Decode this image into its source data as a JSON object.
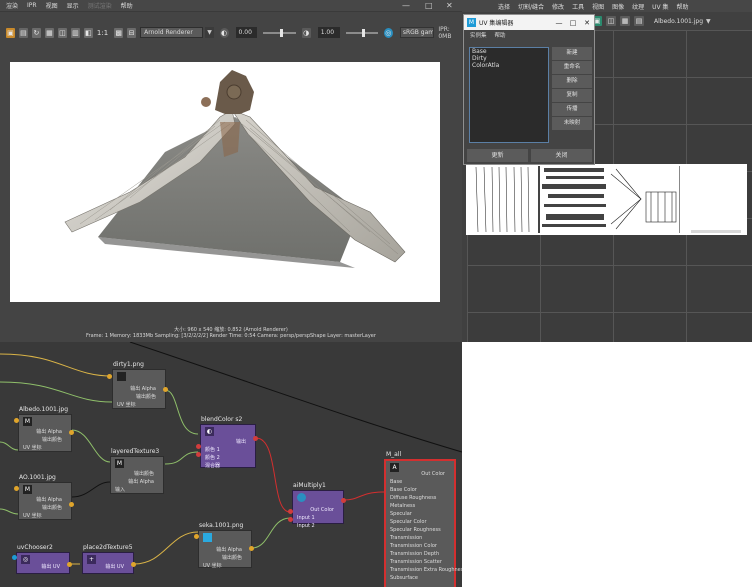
{
  "render_view": {
    "menus": [
      "渲染",
      "IPR",
      "视图",
      "显示",
      "测试渲染",
      "帮助"
    ],
    "disabled_menu_index": 4,
    "toolbar": {
      "scale_label": "1:1",
      "renderer": "Arnold Renderer",
      "exposure": "0.00",
      "gamma": "1.00",
      "colorspace": "sRGB gamma",
      "ipr_memory": "IPR: 0MB"
    },
    "info_line1": "大小: 960 x 540  缩放: 0.852    (Arnold Renderer)",
    "info_line2": "Frame: 1    Memory: 1833Mb    Sampling: [3/2/2/2/2]    Render Time: 0:54    Camera: persp/perspShape    Layer: masterLayer"
  },
  "uv_editor": {
    "menus": [
      "选择",
      "切割/缝合",
      "修改",
      "工具",
      "视图",
      "图像",
      "纹理",
      "UV 集",
      "帮助"
    ],
    "texture_name": "Albedo.1001.jpg"
  },
  "uv_set_dialog": {
    "title": "UV 集编辑器",
    "menus": [
      "实例集",
      "帮助"
    ],
    "sets": [
      "Base",
      "Dirty",
      "ColorAtla"
    ],
    "side_buttons": [
      "新建",
      "重命名",
      "删除",
      "复制",
      "传播",
      "未映射"
    ],
    "update_button": "更新",
    "close_button": "关闭"
  },
  "node_editor": {
    "nodes": {
      "dirty": {
        "title": "dirty1.png",
        "rows": [
          "输出 Alpha",
          "输出颜色",
          "UV 坐标"
        ]
      },
      "albedo": {
        "title": "Albedo.1001.jpg",
        "rows": [
          "输出 Alpha",
          "输出颜色",
          "UV 坐标"
        ]
      },
      "ao": {
        "title": "AO.1001.jpg",
        "rows": [
          "输出 Alpha",
          "输出颜色",
          "UV 坐标"
        ]
      },
      "layered": {
        "title": "layeredTexture3",
        "rows": [
          "输出颜色",
          "输出 Alpha",
          "输入"
        ]
      },
      "blend": {
        "title": "blendColor s2",
        "rows": [
          "输出",
          "颜色 1",
          "颜色 2",
          "混合器"
        ]
      },
      "multiply": {
        "title": "aiMultiply1",
        "rows": [
          "Out Color",
          "Input 1",
          "Input 2"
        ]
      },
      "seka": {
        "title": "seka.1001.png",
        "rows": [
          "输出 Alpha",
          "输出颜色",
          "UV 坐标"
        ]
      },
      "uvchooser": {
        "title": "uvChooser2",
        "rows": [
          "输出 UV"
        ]
      },
      "place2d": {
        "title": "place2dTexture5",
        "rows": [
          "输出 UV"
        ]
      },
      "mall": {
        "title": "M_all",
        "out_label": "Out Color",
        "rows": [
          "Base",
          "Base Color",
          "Diffuse Roughness",
          "Metalness",
          "Specular",
          "Specular Color",
          "Specular Roughness",
          "Transmission",
          "Transmission Color",
          "Transmission Depth",
          "Transmission Scatter",
          "Transmission Extra Roughness",
          "Subsurface"
        ]
      }
    }
  },
  "colors": {
    "maya_panel": "#444444",
    "node_purple": "#6a4f99",
    "port_yellow": "#e0a52b",
    "port_red": "#d23c3c",
    "port_green": "#9bc47a",
    "wire_yellow": "#d9b347",
    "wire_green": "#8fbf6a",
    "wire_red": "#d32f2f",
    "accent_blue": "#1e9bd7"
  }
}
